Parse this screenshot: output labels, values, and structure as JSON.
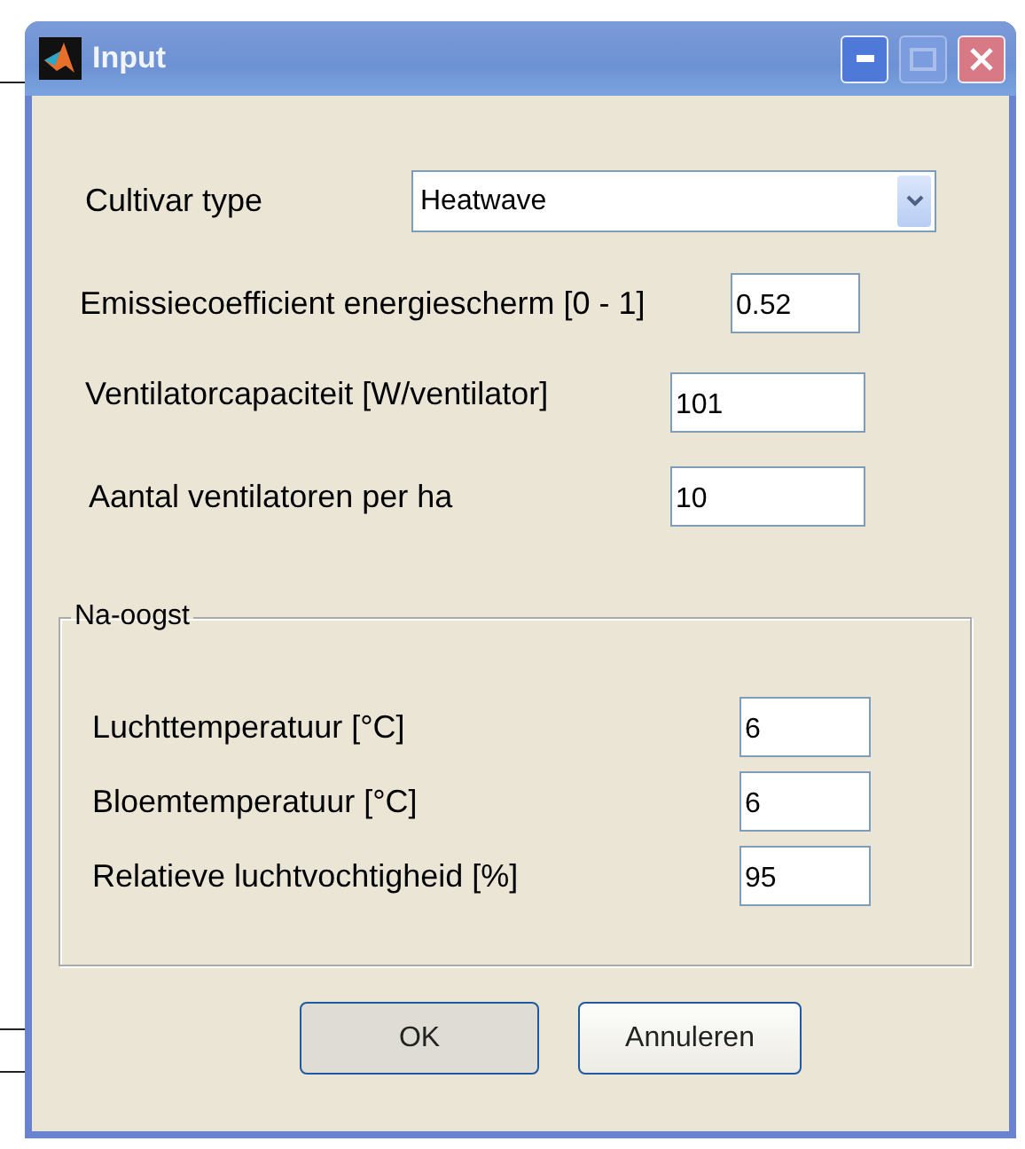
{
  "window": {
    "title": "Input"
  },
  "cultivar": {
    "label": "Cultivar type",
    "value": "Heatwave"
  },
  "fields": [
    {
      "label": "Emissiecoefficient energiescherm [0 - 1]",
      "value": "0.52"
    },
    {
      "label": "Ventilatorcapaciteit [W/ventilator]",
      "value": "101"
    },
    {
      "label": "Aantal ventilatoren per ha",
      "value": "10"
    }
  ],
  "group": {
    "title": "Na-oogst",
    "fields": [
      {
        "label": "Luchttemperatuur [°C]",
        "value": "6"
      },
      {
        "label": "Bloemtemperatuur [°C]",
        "value": "6"
      },
      {
        "label": "Relatieve luchtvochtigheid [%]",
        "value": "95"
      }
    ]
  },
  "buttons": [
    {
      "label": "OK",
      "default": true
    },
    {
      "label": "Annuleren",
      "default": false
    }
  ]
}
